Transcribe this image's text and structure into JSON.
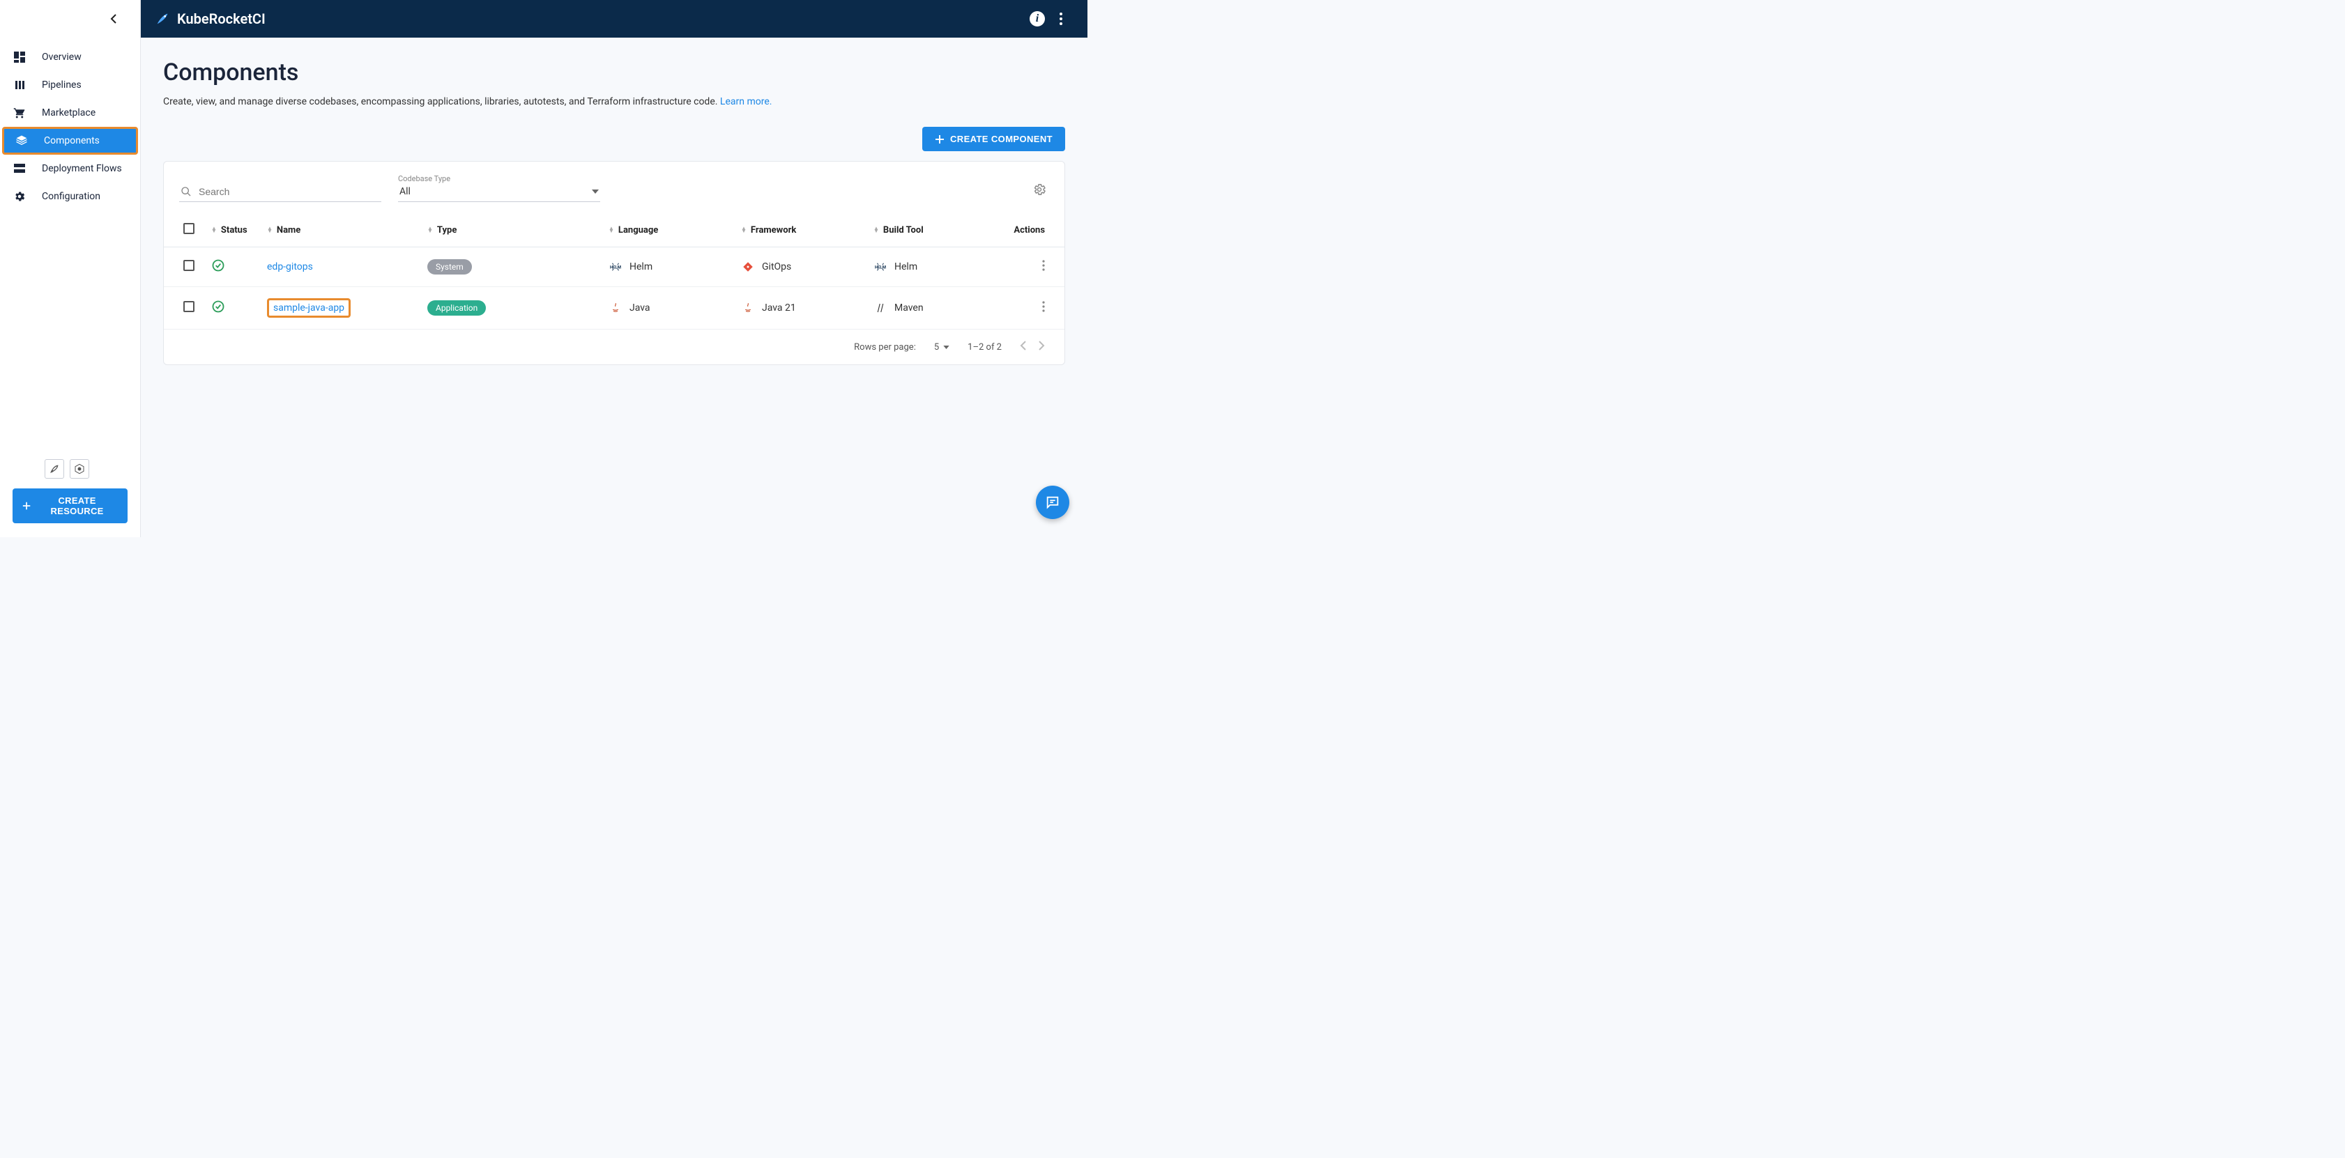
{
  "brand": "KubeRocketCI",
  "sidebar": {
    "items": [
      {
        "label": "Overview"
      },
      {
        "label": "Pipelines"
      },
      {
        "label": "Marketplace"
      },
      {
        "label": "Components"
      },
      {
        "label": "Deployment Flows"
      },
      {
        "label": "Configuration"
      }
    ],
    "create_resource": "CREATE RESOURCE"
  },
  "page": {
    "title": "Components",
    "subtitle": "Create, view, and manage diverse codebases, encompassing applications, libraries, autotests, and Terraform infrastructure code. ",
    "learn_more": "Learn more."
  },
  "buttons": {
    "create_component": "CREATE COMPONENT"
  },
  "filters": {
    "search_placeholder": "Search",
    "codebase_type_label": "Codebase Type",
    "codebase_type_value": "All"
  },
  "table": {
    "headers": {
      "status": "Status",
      "name": "Name",
      "type": "Type",
      "language": "Language",
      "framework": "Framework",
      "build_tool": "Build Tool",
      "actions": "Actions"
    },
    "rows": [
      {
        "name": "edp-gitops",
        "type": "System",
        "type_class": "system",
        "language": "Helm",
        "framework": "GitOps",
        "build_tool": "Helm",
        "highlight": false
      },
      {
        "name": "sample-java-app",
        "type": "Application",
        "type_class": "application",
        "language": "Java",
        "framework": "Java 21",
        "build_tool": "Maven",
        "highlight": true
      }
    ]
  },
  "pagination": {
    "rows_per_page_label": "Rows per page:",
    "rows_per_page_value": "5",
    "range": "1–2 of 2"
  }
}
